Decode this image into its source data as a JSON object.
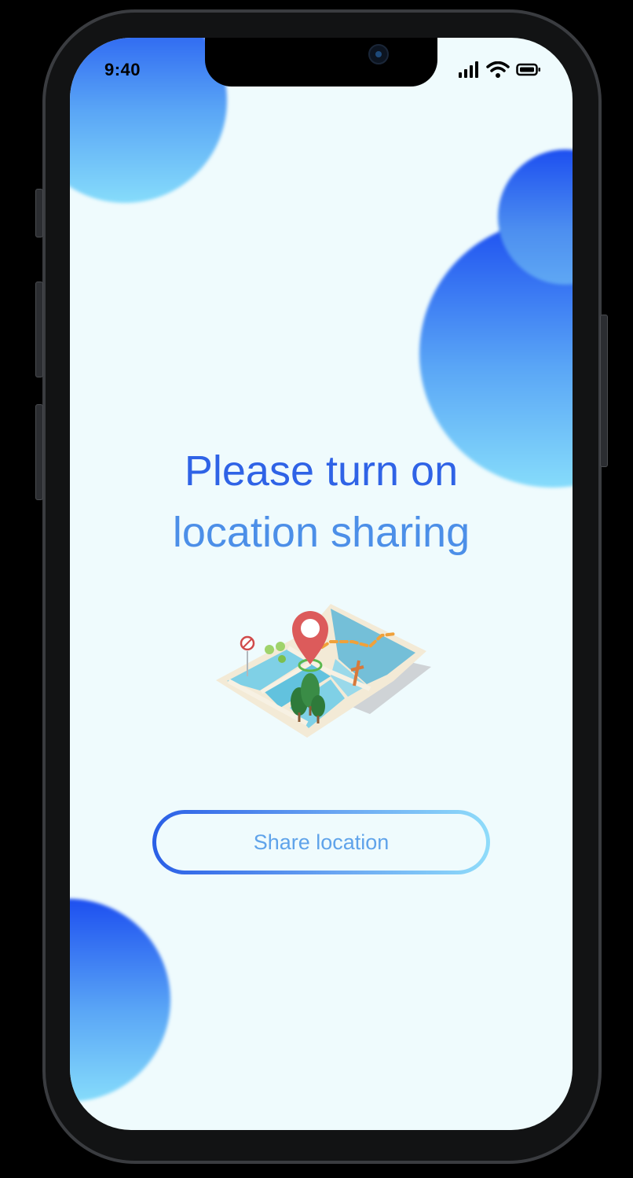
{
  "status_bar": {
    "time": "9:40",
    "signal_icon": "cellular-signal-icon",
    "wifi_icon": "wifi-icon",
    "battery_icon": "battery-icon"
  },
  "content": {
    "headline_line1": "Please turn on",
    "headline_line2": "location sharing",
    "illustration": "map-location-illustration"
  },
  "actions": {
    "share_label": "Share location"
  },
  "colors": {
    "background": "#effbfd",
    "accent_dark": "#2f63e6",
    "accent_light": "#86dcfb"
  }
}
